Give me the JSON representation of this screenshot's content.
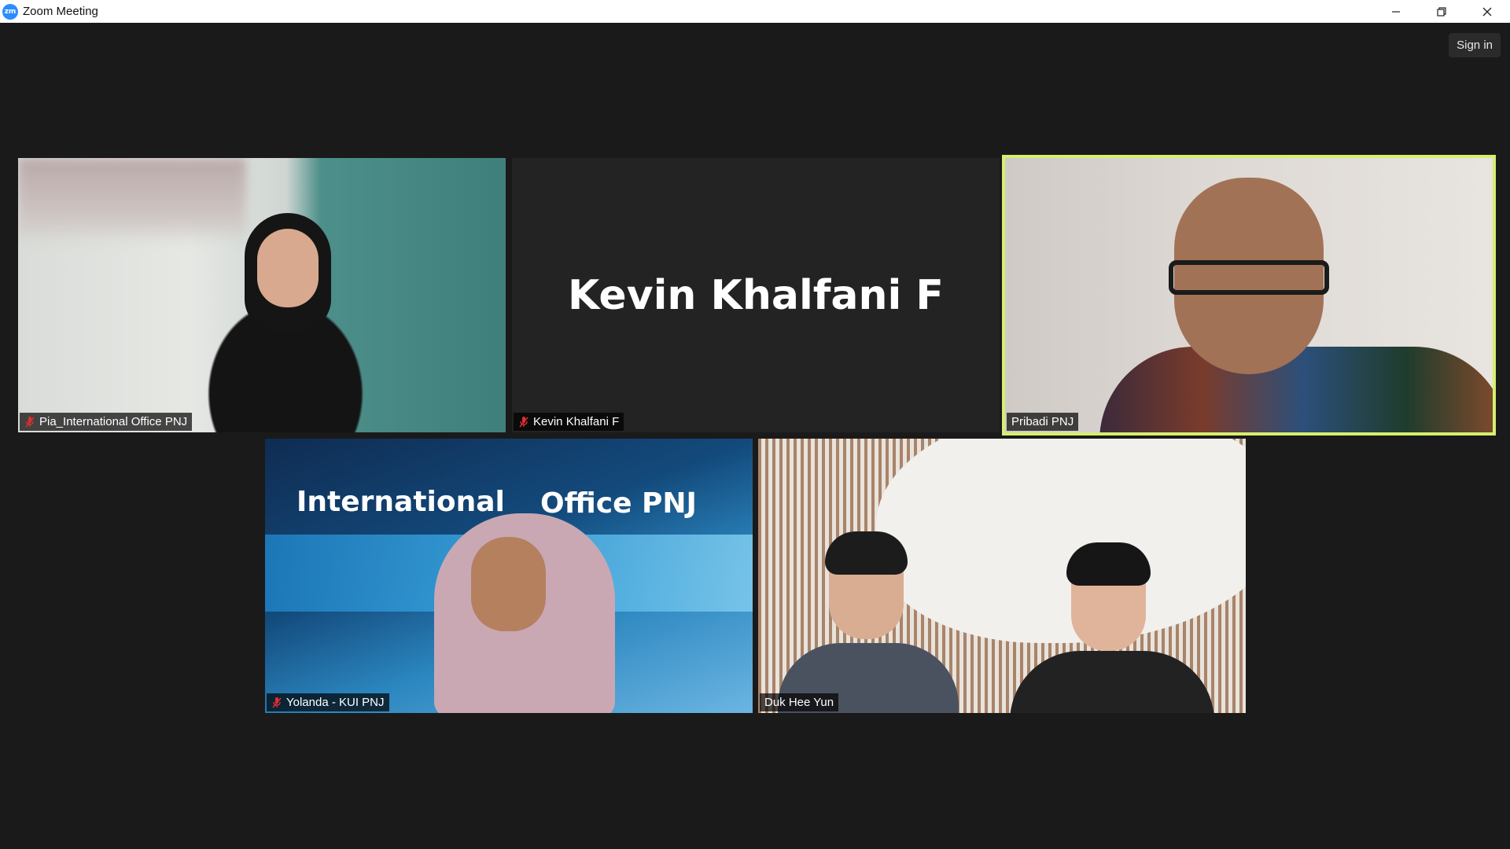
{
  "window": {
    "title": "Zoom Meeting",
    "logo_text": "zm",
    "controls": [
      "minimize-icon",
      "restore-icon",
      "close-icon"
    ]
  },
  "toolbar": {
    "sign_in_label": "Sign in"
  },
  "participants": [
    {
      "name": "Pia_International Office PNJ",
      "muted": true,
      "video": true,
      "active_speaker": false
    },
    {
      "name": "Kevin Khalfani F",
      "muted": true,
      "video": false,
      "active_speaker": false,
      "display_name": "Kevin Khalfani F"
    },
    {
      "name": "Pribadi PNJ",
      "muted": false,
      "video": true,
      "active_speaker": true
    },
    {
      "name": "Yolanda - KUI PNJ",
      "muted": true,
      "video": true,
      "active_speaker": false,
      "background_text": [
        "International",
        "Office PNJ"
      ]
    },
    {
      "name": "Duk Hee Yun",
      "muted": false,
      "video": true,
      "active_speaker": false
    }
  ],
  "colors": {
    "stage": "#1a1a1a",
    "active_speaker_border": "#d6ef6e",
    "muted_icon": "#e02f2f",
    "zoom_brand": "#2d8cff"
  }
}
